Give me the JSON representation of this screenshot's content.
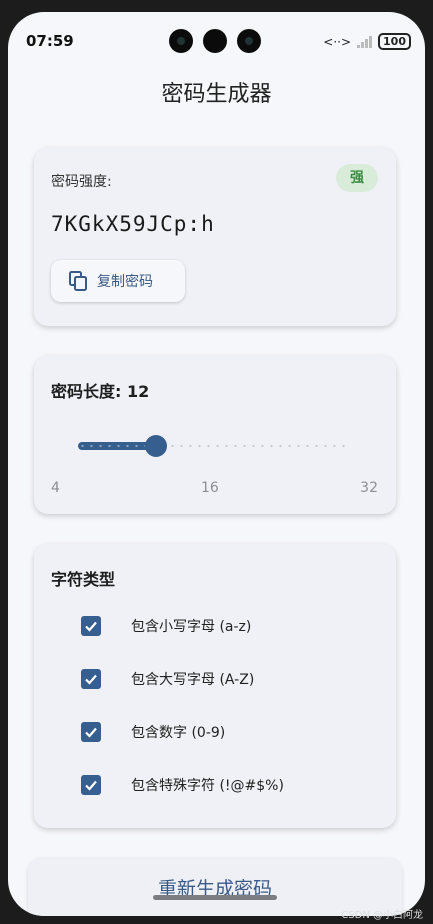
{
  "status": {
    "time": "07:59",
    "network_indicator": "<··>",
    "battery": "100"
  },
  "app": {
    "title": "密码生成器"
  },
  "strength_card": {
    "label": "密码强度:",
    "badge": "强",
    "password": "7KGkX59JCp:h",
    "copy_button": "复制密码"
  },
  "length_card": {
    "title": "密码长度: 12",
    "value": 12,
    "min": 4,
    "max": 32,
    "ticks": [
      "4",
      "16",
      "32"
    ]
  },
  "charset_card": {
    "title": "字符类型",
    "options": [
      {
        "label": "包含小写字母 (a-z)",
        "checked": true
      },
      {
        "label": "包含大写字母 (A-Z)",
        "checked": true
      },
      {
        "label": "包含数字 (0-9)",
        "checked": true
      },
      {
        "label": "包含特殊字符 (!@#$%)",
        "checked": true
      }
    ]
  },
  "regenerate_button": "重新生成密码",
  "watermark": "CSDN @小白阿龙",
  "colors": {
    "accent": "#365e8e",
    "badge_bg": "#d8ecd9",
    "badge_text": "#3a8d40"
  }
}
